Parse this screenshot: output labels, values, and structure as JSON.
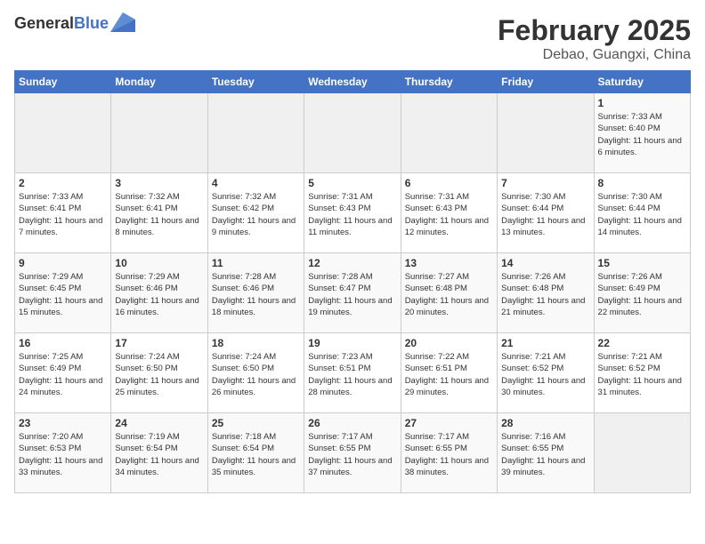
{
  "app": {
    "logo_general": "General",
    "logo_blue": "Blue"
  },
  "calendar": {
    "title": "February 2025",
    "subtitle": "Debao, Guangxi, China",
    "days_of_week": [
      "Sunday",
      "Monday",
      "Tuesday",
      "Wednesday",
      "Thursday",
      "Friday",
      "Saturday"
    ],
    "weeks": [
      [
        {
          "day": "",
          "info": ""
        },
        {
          "day": "",
          "info": ""
        },
        {
          "day": "",
          "info": ""
        },
        {
          "day": "",
          "info": ""
        },
        {
          "day": "",
          "info": ""
        },
        {
          "day": "",
          "info": ""
        },
        {
          "day": "1",
          "info": "Sunrise: 7:33 AM\nSunset: 6:40 PM\nDaylight: 11 hours and 6 minutes."
        }
      ],
      [
        {
          "day": "2",
          "info": "Sunrise: 7:33 AM\nSunset: 6:41 PM\nDaylight: 11 hours and 7 minutes."
        },
        {
          "day": "3",
          "info": "Sunrise: 7:32 AM\nSunset: 6:41 PM\nDaylight: 11 hours and 8 minutes."
        },
        {
          "day": "4",
          "info": "Sunrise: 7:32 AM\nSunset: 6:42 PM\nDaylight: 11 hours and 9 minutes."
        },
        {
          "day": "5",
          "info": "Sunrise: 7:31 AM\nSunset: 6:43 PM\nDaylight: 11 hours and 11 minutes."
        },
        {
          "day": "6",
          "info": "Sunrise: 7:31 AM\nSunset: 6:43 PM\nDaylight: 11 hours and 12 minutes."
        },
        {
          "day": "7",
          "info": "Sunrise: 7:30 AM\nSunset: 6:44 PM\nDaylight: 11 hours and 13 minutes."
        },
        {
          "day": "8",
          "info": "Sunrise: 7:30 AM\nSunset: 6:44 PM\nDaylight: 11 hours and 14 minutes."
        }
      ],
      [
        {
          "day": "9",
          "info": "Sunrise: 7:29 AM\nSunset: 6:45 PM\nDaylight: 11 hours and 15 minutes."
        },
        {
          "day": "10",
          "info": "Sunrise: 7:29 AM\nSunset: 6:46 PM\nDaylight: 11 hours and 16 minutes."
        },
        {
          "day": "11",
          "info": "Sunrise: 7:28 AM\nSunset: 6:46 PM\nDaylight: 11 hours and 18 minutes."
        },
        {
          "day": "12",
          "info": "Sunrise: 7:28 AM\nSunset: 6:47 PM\nDaylight: 11 hours and 19 minutes."
        },
        {
          "day": "13",
          "info": "Sunrise: 7:27 AM\nSunset: 6:48 PM\nDaylight: 11 hours and 20 minutes."
        },
        {
          "day": "14",
          "info": "Sunrise: 7:26 AM\nSunset: 6:48 PM\nDaylight: 11 hours and 21 minutes."
        },
        {
          "day": "15",
          "info": "Sunrise: 7:26 AM\nSunset: 6:49 PM\nDaylight: 11 hours and 22 minutes."
        }
      ],
      [
        {
          "day": "16",
          "info": "Sunrise: 7:25 AM\nSunset: 6:49 PM\nDaylight: 11 hours and 24 minutes."
        },
        {
          "day": "17",
          "info": "Sunrise: 7:24 AM\nSunset: 6:50 PM\nDaylight: 11 hours and 25 minutes."
        },
        {
          "day": "18",
          "info": "Sunrise: 7:24 AM\nSunset: 6:50 PM\nDaylight: 11 hours and 26 minutes."
        },
        {
          "day": "19",
          "info": "Sunrise: 7:23 AM\nSunset: 6:51 PM\nDaylight: 11 hours and 28 minutes."
        },
        {
          "day": "20",
          "info": "Sunrise: 7:22 AM\nSunset: 6:51 PM\nDaylight: 11 hours and 29 minutes."
        },
        {
          "day": "21",
          "info": "Sunrise: 7:21 AM\nSunset: 6:52 PM\nDaylight: 11 hours and 30 minutes."
        },
        {
          "day": "22",
          "info": "Sunrise: 7:21 AM\nSunset: 6:52 PM\nDaylight: 11 hours and 31 minutes."
        }
      ],
      [
        {
          "day": "23",
          "info": "Sunrise: 7:20 AM\nSunset: 6:53 PM\nDaylight: 11 hours and 33 minutes."
        },
        {
          "day": "24",
          "info": "Sunrise: 7:19 AM\nSunset: 6:54 PM\nDaylight: 11 hours and 34 minutes."
        },
        {
          "day": "25",
          "info": "Sunrise: 7:18 AM\nSunset: 6:54 PM\nDaylight: 11 hours and 35 minutes."
        },
        {
          "day": "26",
          "info": "Sunrise: 7:17 AM\nSunset: 6:55 PM\nDaylight: 11 hours and 37 minutes."
        },
        {
          "day": "27",
          "info": "Sunrise: 7:17 AM\nSunset: 6:55 PM\nDaylight: 11 hours and 38 minutes."
        },
        {
          "day": "28",
          "info": "Sunrise: 7:16 AM\nSunset: 6:55 PM\nDaylight: 11 hours and 39 minutes."
        },
        {
          "day": "",
          "info": ""
        }
      ]
    ]
  }
}
